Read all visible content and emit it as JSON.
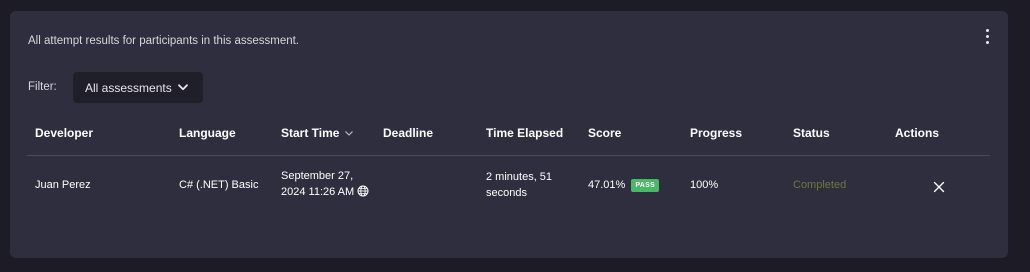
{
  "panel": {
    "description": "All attempt results for participants in this assessment.",
    "menu_icon": "kebab-vertical-icon"
  },
  "filter": {
    "label": "Filter:",
    "selected": "All assessments",
    "icon": "chevron-down-icon"
  },
  "table": {
    "columns": [
      {
        "key": "developer",
        "label": "Developer"
      },
      {
        "key": "language",
        "label": "Language"
      },
      {
        "key": "start_time",
        "label": "Start Time",
        "sort_icon": "chevron-down-icon"
      },
      {
        "key": "deadline",
        "label": "Deadline"
      },
      {
        "key": "time_elapsed",
        "label": "Time Elapsed"
      },
      {
        "key": "score",
        "label": "Score"
      },
      {
        "key": "progress",
        "label": "Progress"
      },
      {
        "key": "status",
        "label": "Status"
      },
      {
        "key": "actions",
        "label": "Actions"
      }
    ],
    "rows": [
      {
        "developer": "Juan Perez",
        "language": "C# (.NET) Basic",
        "start_time_line1": "September 27,",
        "start_time_line2": "2024 11:26 AM",
        "start_time_icon": "globe-icon",
        "deadline": "",
        "time_elapsed_line1": "2 minutes, 51",
        "time_elapsed_line2": "seconds",
        "score": "47.01%",
        "score_badge": "PASS",
        "progress": "100%",
        "status": "Completed",
        "action_icon": "close-icon"
      }
    ]
  },
  "colors": {
    "page_bg": "#1d1c26",
    "panel_bg": "#2e2e3e",
    "select_bg": "#1f1e29",
    "pass_badge": "#4ab866",
    "status_completed": "#6b7a3c"
  }
}
